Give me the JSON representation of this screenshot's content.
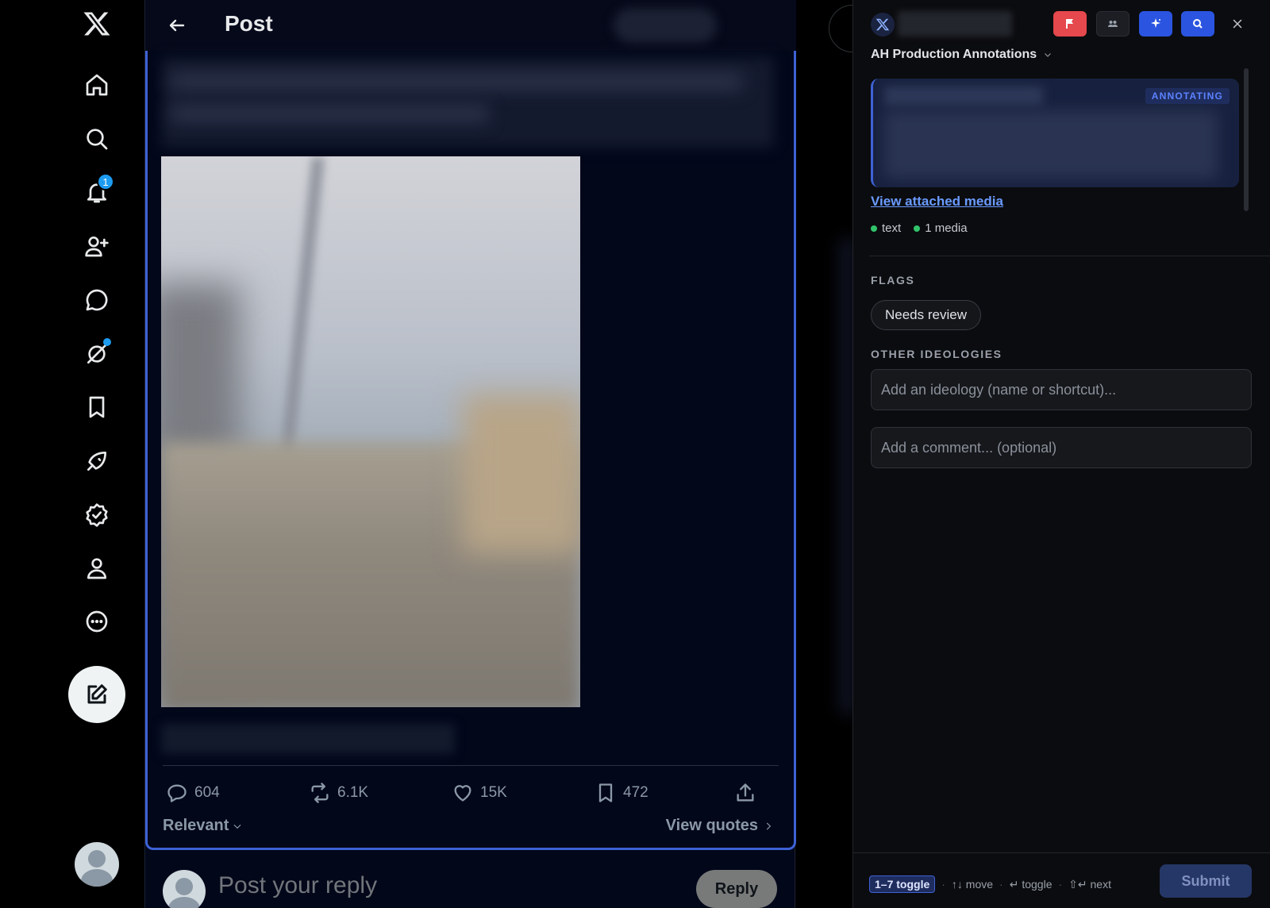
{
  "main": {
    "title": "Post",
    "stats": {
      "replies": "604",
      "reposts": "6.1K",
      "likes": "15K",
      "bookmarks": "472"
    },
    "sort_label": "Relevant",
    "view_quotes": "View quotes",
    "reply_placeholder": "Post your reply",
    "reply_button": "Reply"
  },
  "nav": {
    "notification_count": "1",
    "icons": [
      "x-logo-icon",
      "home-icon",
      "search-icon",
      "bell-icon",
      "follow-icon",
      "messages-icon",
      "grok-icon",
      "bookmark-icon",
      "rocket-icon",
      "verified-icon",
      "profile-icon",
      "more-icon",
      "compose-icon"
    ]
  },
  "panel": {
    "project": "AH Production Annotations",
    "status_badge": "ANNOTATING",
    "media_link": "View attached media",
    "tags": [
      "text",
      "1 media"
    ],
    "flags_label": "FLAGS",
    "flag_chip": "Needs review",
    "ideologies_label": "OTHER IDEOLOGIES",
    "ideology_placeholder": "Add an ideology (name or shortcut)...",
    "comment_placeholder": "Add a comment... (optional)",
    "hints": {
      "toggle_key": "1–7 toggle",
      "move": "↑↓ move",
      "toggle": "↵ toggle",
      "next": "⇧↵ next"
    },
    "submit": "Submit",
    "colors": {
      "accent": "#3e62d6",
      "flag": "#e5484d",
      "ok": "#31c46b"
    }
  }
}
